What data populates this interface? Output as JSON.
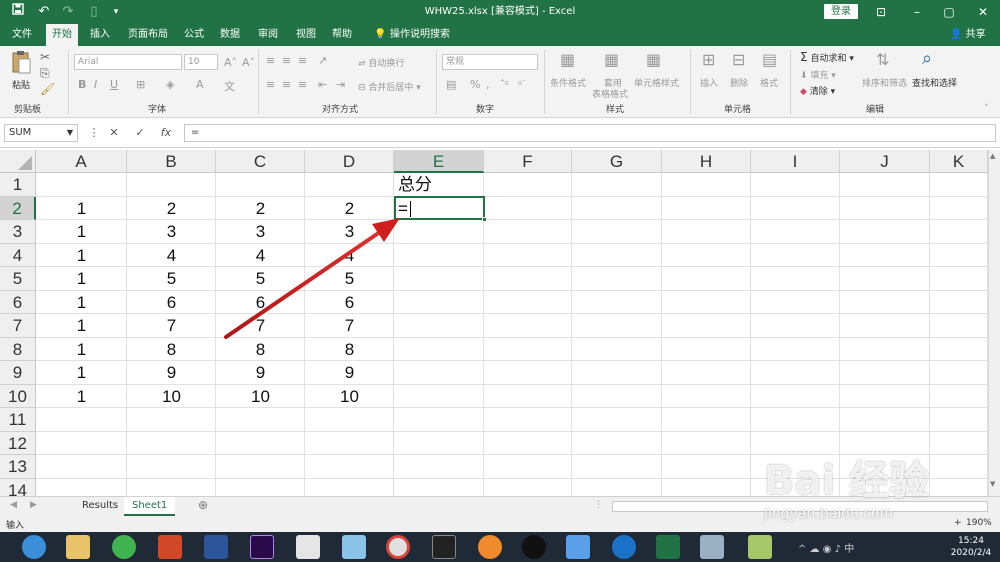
{
  "window": {
    "title": "WHW25.xlsx [兼容模式] - Excel",
    "login": "登录",
    "controls": [
      "⊡",
      "–",
      "▢",
      "✕"
    ]
  },
  "quick_access": {
    "save_icon": "save-icon",
    "undo_icon": "undo-icon",
    "redo_icon": "redo-icon",
    "new_icon": "new-document-icon",
    "customize_icon": "customize-icon"
  },
  "tabs": [
    "文件",
    "开始",
    "插入",
    "页面布局",
    "公式",
    "数据",
    "审阅",
    "视图",
    "帮助"
  ],
  "tell_me": "操作说明搜索",
  "share": "共享",
  "ribbon": {
    "clipboard": {
      "label": "剪贴板",
      "paste": "粘贴"
    },
    "font": {
      "label": "字体",
      "name": "Arial",
      "size": "10"
    },
    "alignment": {
      "label": "对齐方式",
      "wrap": "自动换行",
      "merge": "合并后居中"
    },
    "number": {
      "label": "数字",
      "format": "常规"
    },
    "styles": {
      "label": "样式",
      "conditional": "条件格式",
      "table_line1": "套用",
      "table_line2": "表格格式",
      "cell_styles": "单元格样式"
    },
    "cells": {
      "label": "单元格",
      "insert": "插入",
      "delete": "删除",
      "format": "格式"
    },
    "editing": {
      "label": "编辑",
      "autosum": "自动求和",
      "fill": "填充",
      "clear": "清除",
      "sort": "排序和筛选",
      "find": "查找和选择"
    }
  },
  "formula_bar": {
    "name_box": "SUM",
    "cancel": "✕",
    "enter": "✓",
    "fx": "fx",
    "content": "="
  },
  "columns": [
    "A",
    "B",
    "C",
    "D",
    "E",
    "F",
    "G",
    "H",
    "I",
    "J",
    "K"
  ],
  "rows": [
    "1",
    "2",
    "3",
    "4",
    "5",
    "6",
    "7",
    "8",
    "9",
    "10",
    "11",
    "12",
    "13",
    "14"
  ],
  "cells": {
    "E1": "总分",
    "data": [
      [
        "1",
        "2",
        "2",
        "2"
      ],
      [
        "1",
        "3",
        "3",
        "3"
      ],
      [
        "1",
        "4",
        "4",
        "4"
      ],
      [
        "1",
        "5",
        "5",
        "5"
      ],
      [
        "1",
        "6",
        "6",
        "6"
      ],
      [
        "1",
        "7",
        "7",
        "7"
      ],
      [
        "1",
        "8",
        "8",
        "8"
      ],
      [
        "1",
        "9",
        "9",
        "9"
      ],
      [
        "1",
        "10",
        "10",
        "10"
      ]
    ],
    "E2": "="
  },
  "sheets": [
    "Results",
    "Sheet1"
  ],
  "active_sheet": "Sheet1",
  "status": {
    "mode": "输入",
    "zoom": "190%"
  },
  "watermark": {
    "text": "Bai 经验",
    "url": "jingyan.baidu.com"
  },
  "taskbar": {
    "time": "15:24",
    "date": "2020/2/4"
  },
  "colors": {
    "excel_green": "#217346",
    "arrow": "#d11f1f"
  }
}
